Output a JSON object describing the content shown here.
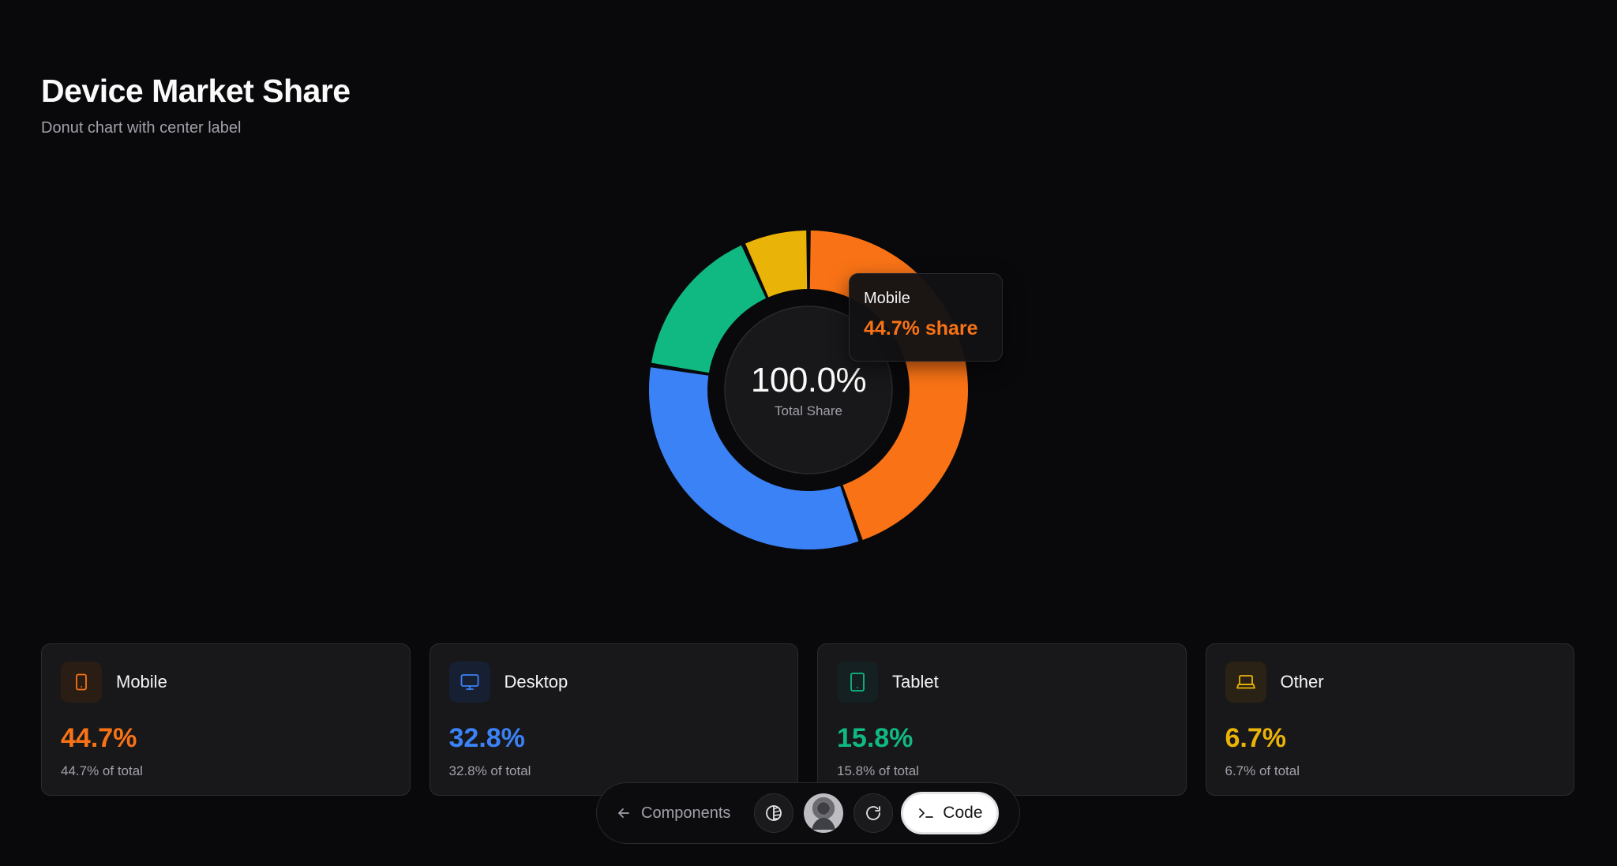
{
  "header": {
    "title": "Device Market Share",
    "subtitle": "Donut chart with center label"
  },
  "chart_data": {
    "type": "pie",
    "variant": "donut",
    "title": "Device Market Share",
    "subtitle": "Donut chart with center label",
    "center_value": "100.0%",
    "center_caption": "Total Share",
    "categories": [
      "Mobile",
      "Desktop",
      "Tablet",
      "Other"
    ],
    "values": [
      44.7,
      32.8,
      15.8,
      6.7
    ],
    "colors": [
      "#f97316",
      "#3b82f6",
      "#10b981",
      "#eab308"
    ],
    "start_angle_deg": 90,
    "direction": "counterclockwise",
    "active_index": 0,
    "tooltip": {
      "name": "Mobile",
      "value": "44.7% share"
    }
  },
  "cards": [
    {
      "label": "Mobile",
      "value": "44.7%",
      "note": "44.7% of total",
      "color": "#f97316",
      "icon_bg": "#2a1d14",
      "icon": "smartphone-icon"
    },
    {
      "label": "Desktop",
      "value": "32.8%",
      "note": "32.8% of total",
      "color": "#3b82f6",
      "icon_bg": "#172033",
      "icon": "monitor-icon"
    },
    {
      "label": "Tablet",
      "value": "15.8%",
      "note": "15.8% of total",
      "color": "#10b981",
      "icon_bg": "#142022",
      "icon": "tablet-icon"
    },
    {
      "label": "Other",
      "value": "6.7%",
      "note": "6.7% of total",
      "color": "#eab308",
      "icon_bg": "#2a2214",
      "icon": "laptop-icon"
    }
  ],
  "toolbar": {
    "back_label": "Components",
    "code_label": "Code"
  }
}
